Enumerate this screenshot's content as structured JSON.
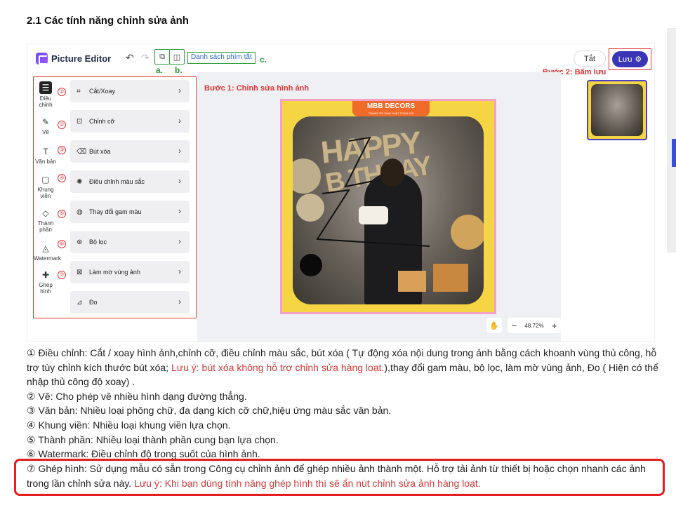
{
  "page_title": "2.1 Các tính năng chỉnh sửa ảnh",
  "editor": {
    "brand": "Picture Editor",
    "shortcuts_label": "Danh sách phím tắt",
    "label_a": "a.",
    "label_b": "b.",
    "label_c": "c.",
    "exit_label": "Tắt",
    "save_label": "Lưu",
    "step1": "Bước 1: Chỉnh sửa hình ảnh",
    "step2": "Bước 2: Bấm lưu",
    "banner": "MBB DECORS",
    "banner_sub": "TRANG TRÍ SINH NHẬT TRỌN GÓI",
    "photo_text_happy": "HAPPY",
    "photo_text_bday": "B THDAY",
    "zoom": "48.72%",
    "zoom_minus": "−",
    "zoom_plus": "+",
    "rail": [
      {
        "label": "Điều chỉnh",
        "badge": "①",
        "icon": "sliders-icon"
      },
      {
        "label": "Vẽ",
        "badge": "②",
        "icon": "pen-icon"
      },
      {
        "label": "Văn bản",
        "badge": "③",
        "icon": "text-icon"
      },
      {
        "label": "Khung viền",
        "badge": "④",
        "icon": "frame-icon"
      },
      {
        "label": "Thành phần",
        "badge": "⑤",
        "icon": "shapes-icon"
      },
      {
        "label": "Watermark",
        "badge": "⑥",
        "icon": "watermark-icon"
      },
      {
        "label": "Ghép hình",
        "badge": "⑦",
        "icon": "puzzle-icon"
      }
    ],
    "menu": [
      {
        "label": "Cắt/Xoay",
        "icon": "crop-icon"
      },
      {
        "label": "Chỉnh cỡ",
        "icon": "resize-icon"
      },
      {
        "label": "Bút xóa",
        "icon": "eraser-icon"
      },
      {
        "label": "Điều chỉnh màu sắc",
        "icon": "color-adjust-icon"
      },
      {
        "label": "Thay đổi gam màu",
        "icon": "palette-icon"
      },
      {
        "label": "Bộ lọc",
        "icon": "filter-icon"
      },
      {
        "label": "Làm mờ vùng ảnh",
        "icon": "blur-icon"
      },
      {
        "label": "Đo",
        "icon": "ruler-icon"
      }
    ]
  },
  "description": {
    "item1_a": "① Điều chỉnh:  Cắt / xoay hình ảnh,chỉnh cỡ, điều chỉnh màu sắc, bút xóa ( Tự động xóa nội dung trong ảnh bằng cách khoanh vùng thủ công, hỗ trợ tùy chỉnh kích thước bút xóa; ",
    "item1_warn": "Lưu ý: bút xóa không hỗ trợ chỉnh sửa hàng loạt.",
    "item1_b": "),thay đổi gam màu, bộ lọc, làm mờ vùng ảnh, Đo ( Hiện có thể nhập thủ công độ xoay) .",
    "item2": "② Vẽ: Cho phép vẽ nhiều hình dạng đường thẳng.",
    "item3": "③ Văn bản: Nhiều loại phông chữ, đa dạng kích cỡ chữ,hiệu ứng màu sắc văn bản.",
    "item4": "④ Khung viền: Nhiều loại khung viền lựa chọn.",
    "item5": "⑤ Thành phần: Nhiều loại thành phần cung bạn lựa chọn.",
    "item6": "⑥ Watermark: Điều chỉnh độ trong suốt của hình ảnh.",
    "item7_a": "⑦ Ghép hình:  Sử dụng mẫu có sẵn trong Công cụ chỉnh ảnh để ghép nhiều ảnh thành một. Hỗ trợ tải ảnh từ thiết bị hoặc chọn nhanh các ảnh trong lần chỉnh sửa này. ",
    "item7_warn": "Lưu ý: Khi bạn dùng tính năng ghép hình thì sẽ ẩn nút chỉnh sửa ảnh hàng loạt."
  },
  "colors": {
    "accent": "#3b34b6",
    "annotation_red": "#e03434",
    "annotation_green": "#2f9e3f"
  }
}
